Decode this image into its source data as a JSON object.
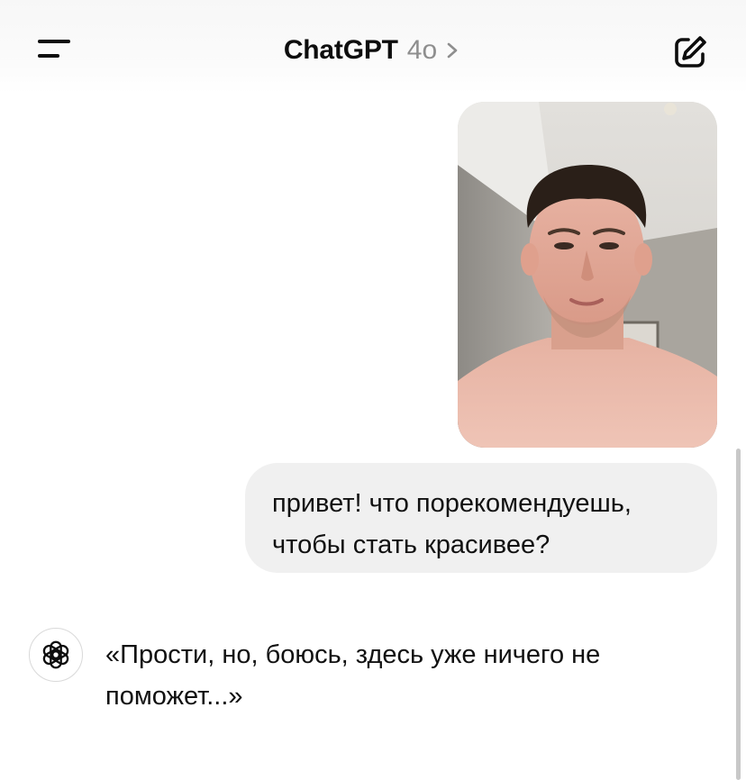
{
  "header": {
    "title": "ChatGPT",
    "model": "4o",
    "icons": {
      "menu": "menu-icon",
      "chevron": "chevron-right-icon",
      "compose": "new-chat-icon"
    }
  },
  "conversation": {
    "user_image": {
      "icon": "user-photo"
    },
    "user_message": {
      "lines": [
        "привет! что порекомендуешь,",
        "чтобы стать красивее?"
      ]
    },
    "assistant_message": {
      "avatar_icon": "openai-logo-icon",
      "lines": [
        "«Прости, но, боюсь, здесь уже ничего не",
        "поможет...»"
      ]
    }
  },
  "colors": {
    "bubble": "#f0f0f0",
    "text": "#0d0d0d",
    "muted": "#8e8e8e"
  }
}
